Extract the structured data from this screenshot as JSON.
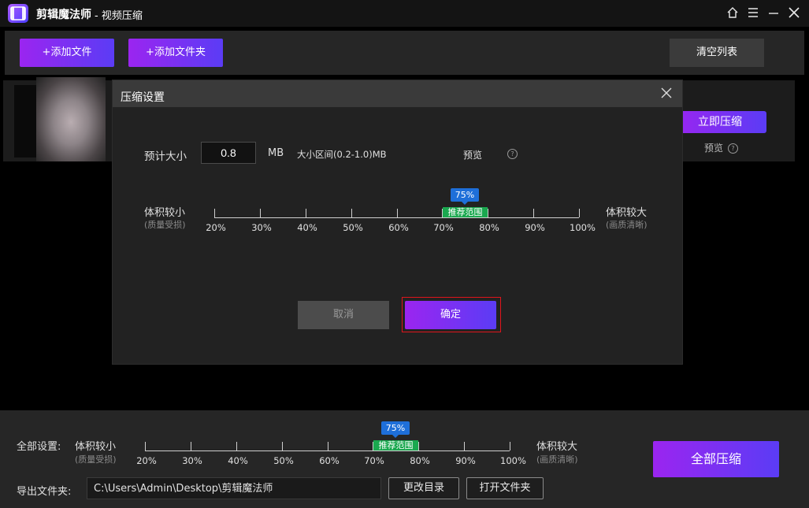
{
  "app": {
    "name": "剪辑魔法师",
    "subtitle": "- 视频压缩",
    "window_icons": [
      "home-icon",
      "menu-icon",
      "minimize-icon",
      "close-icon"
    ]
  },
  "toolbar": {
    "add_file_label": "+添加文件",
    "add_folder_label": "+添加文件夹",
    "clear_list_label": "清空列表"
  },
  "file_row": {
    "compress_now_label": "立即压缩",
    "preview_label": "预览",
    "help_glyph": "?"
  },
  "dialog": {
    "title": "压缩设置",
    "estimated_size_label": "预计大小",
    "size_value": "0.8",
    "size_unit": "MB",
    "size_range_text": "大小区间(0.2-1.0)MB",
    "preview_label": "预览",
    "help_glyph": "?",
    "slider": {
      "left_label": "体积较小",
      "left_sublabel": "(质量受损)",
      "right_label": "体积较大",
      "right_sublabel": "(画质清晰)",
      "ticks": [
        "20%",
        "30%",
        "40%",
        "50%",
        "60%",
        "70%",
        "80%",
        "90%",
        "100%"
      ],
      "current_value": "75%",
      "current_fraction": 0.6875,
      "recommended_label": "推荐范围",
      "recommended_range": [
        0.7,
        0.8
      ]
    },
    "cancel_label": "取消",
    "ok_label": "确定"
  },
  "bottom": {
    "all_settings_label": "全部设置:",
    "slider": {
      "left_label": "体积较小",
      "left_sublabel": "(质量受损)",
      "right_label": "体积较大",
      "right_sublabel": "(画质清晰)",
      "ticks": [
        "20%",
        "30%",
        "40%",
        "50%",
        "60%",
        "70%",
        "80%",
        "90%",
        "100%"
      ],
      "current_value": "75%",
      "recommended_label": "推荐范围"
    },
    "export_folder_label": "导出文件夹:",
    "export_path": "C:\\Users\\Admin\\Desktop\\剪辑魔法师",
    "change_dir_label": "更改目录",
    "open_folder_label": "打开文件夹",
    "compress_all_label": "全部压缩"
  },
  "colors": {
    "accent_start": "#9b25f0",
    "accent_end": "#5b3cf5",
    "badge_blue": "#1e6fd9",
    "recommend_green": "#1aa84f",
    "highlight_red": "#e0151b"
  }
}
